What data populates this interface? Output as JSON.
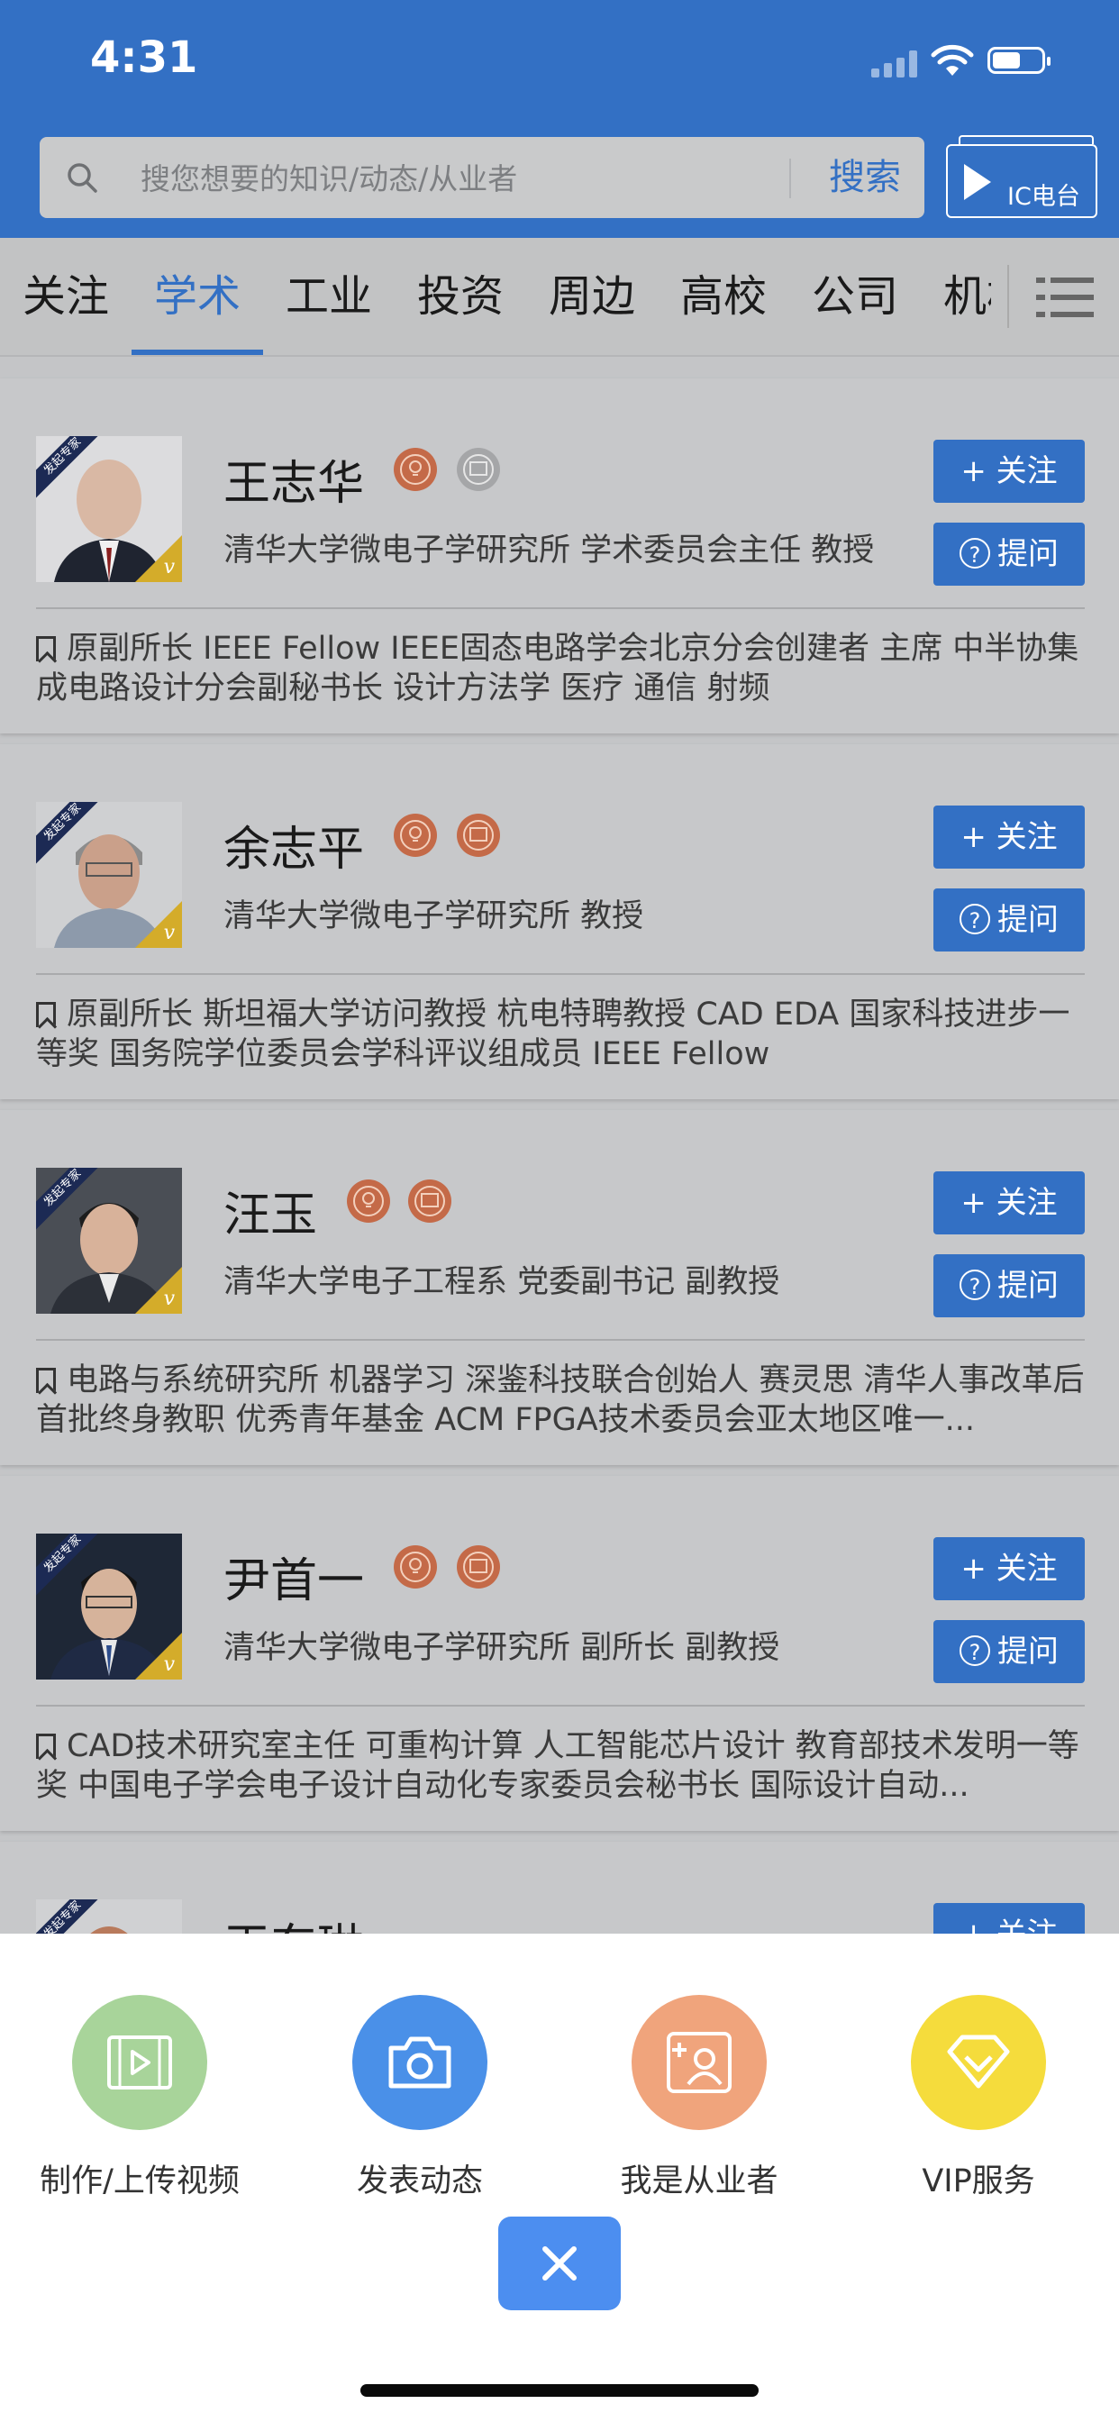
{
  "status": {
    "time": "4:31"
  },
  "search": {
    "placeholder": "搜您想要的知识/动态/从业者",
    "button": "搜索"
  },
  "ic_radio": {
    "label": "IC电台"
  },
  "tabs": [
    "关注",
    "学术",
    "工业",
    "投资",
    "周边",
    "高校",
    "公司",
    "机构"
  ],
  "active_tab": "学术",
  "card_common": {
    "follow": "+ 关注",
    "ask": "提问",
    "ask_icon": "?",
    "avatar_badge": "发起专家",
    "v_mark": "v"
  },
  "experts": [
    {
      "name": "王志华",
      "org": "清华大学微电子学研究所  学术委员会主任 教授",
      "desc": "原副所长 IEEE Fellow IEEE固态电路学会北京分会创建者 主席 中半协集成电路设计分会副秘书长 设计方法学 医疗 通信 射频"
    },
    {
      "name": "余志平",
      "org": "清华大学微电子学研究所  教授",
      "desc": "原副所长 斯坦福大学访问教授 杭电特聘教授 CAD EDA 国家科技进步一等奖 国务院学位委员会学科评议组成员 IEEE Fellow"
    },
    {
      "name": "汪玉",
      "org": "清华大学电子工程系  党委副书记 副教授",
      "desc": "电路与系统研究所 机器学习 深鉴科技联合创始人 赛灵思 清华人事改革后首批终身教职 优秀青年基金 ACM FPGA技术委员会亚太地区唯一..."
    },
    {
      "name": "尹首一",
      "org": "清华大学微电子学研究所  副所长 副教授",
      "desc": "CAD技术研究室主任 可重构计算 人工智能芯片设计 教育部技术发明一等奖 中国电子学会电子设计自动化专家委员会秘书长 国际设计自动..."
    },
    {
      "name": "王东琳",
      "org": "",
      "desc": ""
    }
  ],
  "sheet": {
    "actions": [
      {
        "label": "制作/上传视频",
        "icon": "video-icon",
        "color": "#a8d49a"
      },
      {
        "label": "发表动态",
        "icon": "camera-icon",
        "color": "#4a90e8"
      },
      {
        "label": "我是从业者",
        "icon": "practitioner-icon",
        "color": "#f0a47c"
      },
      {
        "label": "VIP服务",
        "icon": "diamond-icon",
        "color": "#f5dc3c"
      }
    ],
    "close_icon": "close-icon"
  },
  "colors": {
    "brand": "#3370c4",
    "overlay": "#c7c8ca"
  }
}
